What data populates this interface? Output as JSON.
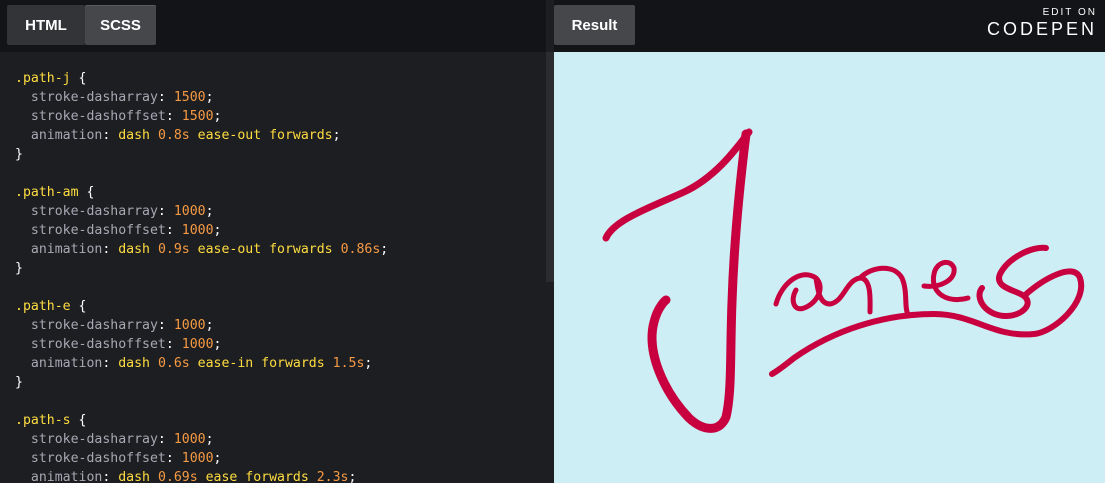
{
  "editor": {
    "tabs": [
      {
        "label": "HTML"
      },
      {
        "label": "SCSS"
      }
    ],
    "code_lines": [
      [
        {
          "t": ".path-j",
          "c": "sel"
        },
        {
          "t": " {",
          "c": "brace"
        }
      ],
      [
        {
          "t": "  stroke-dasharray",
          "c": "prop"
        },
        {
          "t": ": ",
          "c": "punct"
        },
        {
          "t": "1500",
          "c": "num"
        },
        {
          "t": ";",
          "c": "punct"
        }
      ],
      [
        {
          "t": "  stroke-dashoffset",
          "c": "prop"
        },
        {
          "t": ": ",
          "c": "punct"
        },
        {
          "t": "1500",
          "c": "num"
        },
        {
          "t": ";",
          "c": "punct"
        }
      ],
      [
        {
          "t": "  animation",
          "c": "prop"
        },
        {
          "t": ": ",
          "c": "punct"
        },
        {
          "t": "dash ",
          "c": "kw"
        },
        {
          "t": "0.8s",
          "c": "num"
        },
        {
          "t": " ease-out forwards",
          "c": "kw"
        },
        {
          "t": ";",
          "c": "punct"
        }
      ],
      [
        {
          "t": "}",
          "c": "brace"
        }
      ],
      [],
      [
        {
          "t": ".path-am",
          "c": "sel"
        },
        {
          "t": " {",
          "c": "brace"
        }
      ],
      [
        {
          "t": "  stroke-dasharray",
          "c": "prop"
        },
        {
          "t": ": ",
          "c": "punct"
        },
        {
          "t": "1000",
          "c": "num"
        },
        {
          "t": ";",
          "c": "punct"
        }
      ],
      [
        {
          "t": "  stroke-dashoffset",
          "c": "prop"
        },
        {
          "t": ": ",
          "c": "punct"
        },
        {
          "t": "1000",
          "c": "num"
        },
        {
          "t": ";",
          "c": "punct"
        }
      ],
      [
        {
          "t": "  animation",
          "c": "prop"
        },
        {
          "t": ": ",
          "c": "punct"
        },
        {
          "t": "dash ",
          "c": "kw"
        },
        {
          "t": "0.9s",
          "c": "num"
        },
        {
          "t": " ease-out forwards ",
          "c": "kw"
        },
        {
          "t": "0.86s",
          "c": "num"
        },
        {
          "t": ";",
          "c": "punct"
        }
      ],
      [
        {
          "t": "}",
          "c": "brace"
        }
      ],
      [],
      [
        {
          "t": ".path-e",
          "c": "sel"
        },
        {
          "t": " {",
          "c": "brace"
        }
      ],
      [
        {
          "t": "  stroke-dasharray",
          "c": "prop"
        },
        {
          "t": ": ",
          "c": "punct"
        },
        {
          "t": "1000",
          "c": "num"
        },
        {
          "t": ";",
          "c": "punct"
        }
      ],
      [
        {
          "t": "  stroke-dashoffset",
          "c": "prop"
        },
        {
          "t": ": ",
          "c": "punct"
        },
        {
          "t": "1000",
          "c": "num"
        },
        {
          "t": ";",
          "c": "punct"
        }
      ],
      [
        {
          "t": "  animation",
          "c": "prop"
        },
        {
          "t": ": ",
          "c": "punct"
        },
        {
          "t": "dash ",
          "c": "kw"
        },
        {
          "t": "0.6s",
          "c": "num"
        },
        {
          "t": " ease-in forwards ",
          "c": "kw"
        },
        {
          "t": "1.5s",
          "c": "num"
        },
        {
          "t": ";",
          "c": "punct"
        }
      ],
      [
        {
          "t": "}",
          "c": "brace"
        }
      ],
      [],
      [
        {
          "t": ".path-s",
          "c": "sel"
        },
        {
          "t": " {",
          "c": "brace"
        }
      ],
      [
        {
          "t": "  stroke-dasharray",
          "c": "prop"
        },
        {
          "t": ": ",
          "c": "punct"
        },
        {
          "t": "1000",
          "c": "num"
        },
        {
          "t": ";",
          "c": "punct"
        }
      ],
      [
        {
          "t": "  stroke-dashoffset",
          "c": "prop"
        },
        {
          "t": ": ",
          "c": "punct"
        },
        {
          "t": "1000",
          "c": "num"
        },
        {
          "t": ";",
          "c": "punct"
        }
      ],
      [
        {
          "t": "  animation",
          "c": "prop"
        },
        {
          "t": ": ",
          "c": "punct"
        },
        {
          "t": "dash ",
          "c": "kw"
        },
        {
          "t": "0.69s",
          "c": "num"
        },
        {
          "t": " ease forwards ",
          "c": "kw"
        },
        {
          "t": "2.3s",
          "c": "num"
        },
        {
          "t": ";",
          "c": "punct"
        }
      ]
    ]
  },
  "result": {
    "tab_label": "Result",
    "edit_on": "EDIT ON",
    "brand": "CODEPEN",
    "signature_color": "#c8003f",
    "background_color": "#cdeef4"
  }
}
